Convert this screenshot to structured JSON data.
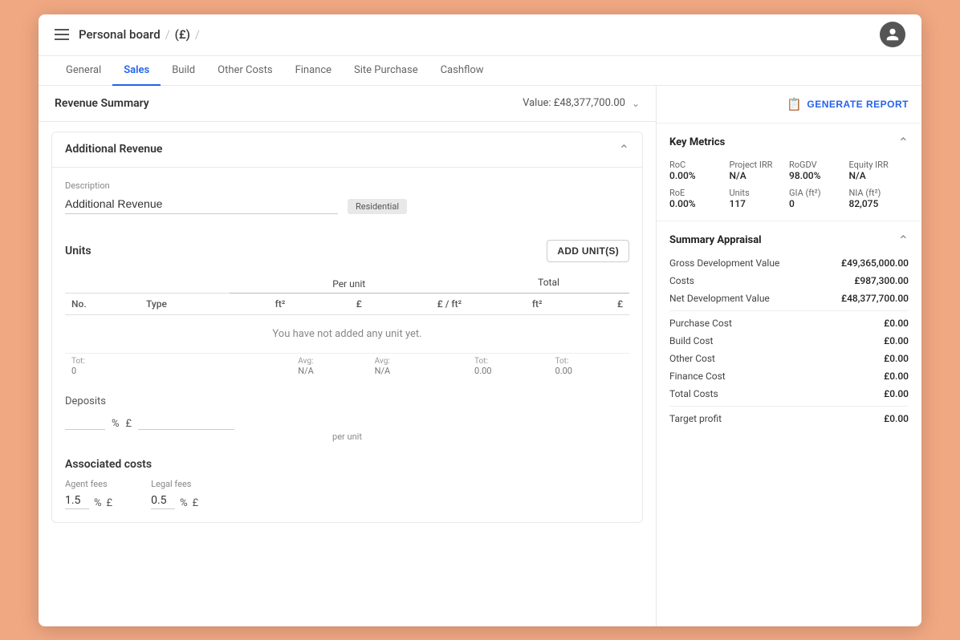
{
  "header": {
    "breadcrumb": {
      "title": "Personal board",
      "sep1": "/",
      "currency": "(£)",
      "sep2": "/"
    }
  },
  "tabs": [
    {
      "label": "General",
      "active": false
    },
    {
      "label": "Sales",
      "active": true
    },
    {
      "label": "Build",
      "active": false
    },
    {
      "label": "Other Costs",
      "active": false
    },
    {
      "label": "Finance",
      "active": false
    },
    {
      "label": "Site Purchase",
      "active": false
    },
    {
      "label": "Cashflow",
      "active": false
    }
  ],
  "revenue_summary": {
    "title": "Revenue Summary",
    "value_label": "Value: £48,377,700.00"
  },
  "additional_revenue": {
    "title": "Additional Revenue",
    "description_label": "Description",
    "description_value": "Additional Revenue",
    "badge": "Residential"
  },
  "units": {
    "title": "Units",
    "add_btn": "ADD UNIT(S)",
    "columns": {
      "no": "No.",
      "type": "Type",
      "per_unit": "Per unit",
      "ft2_per": "ft²",
      "gbp_per": "£",
      "gbp_per_ft2": "£ / ft²",
      "total": "Total",
      "ft2_tot": "ft²",
      "gbp_tot": "£"
    },
    "empty_message": "You have not added any unit yet.",
    "totals": {
      "no_label": "Tot:",
      "no_val": "0",
      "avg_label1": "Avg:",
      "avg_val1": "N/A",
      "avg_label2": "Avg:",
      "avg_val2": "N/A",
      "tot_label1": "Tot:",
      "tot_val1": "0.00",
      "tot_label2": "Tot:",
      "tot_val2": "0.00"
    }
  },
  "deposits": {
    "title": "Deposits",
    "percent_val": "",
    "pound_val": "",
    "per_unit_label": "per unit"
  },
  "associated_costs": {
    "title": "Associated costs",
    "agent_fees_label": "Agent fees",
    "agent_val": "1.5",
    "legal_fees_label": "Legal fees",
    "legal_val": "0.5"
  },
  "right_panel": {
    "generate_report_btn": "GENERATE REPORT",
    "key_metrics": {
      "title": "Key Metrics",
      "items": [
        {
          "label": "RoC",
          "value": "0.00%"
        },
        {
          "label": "Project IRR",
          "value": "N/A"
        },
        {
          "label": "RoGDV",
          "value": "98.00%"
        },
        {
          "label": "Equity IRR",
          "value": "N/A"
        },
        {
          "label": "RoE",
          "value": "0.00%"
        },
        {
          "label": "Units",
          "value": "117"
        },
        {
          "label": "GIA (ft²)",
          "value": "0"
        },
        {
          "label": "NIA (ft²)",
          "value": "82,075"
        }
      ]
    },
    "summary_appraisal": {
      "title": "Summary Appraisal",
      "rows": [
        {
          "label": "Gross Development Value",
          "value": "£49,365,000.00"
        },
        {
          "label": "Costs",
          "value": "£987,300.00"
        },
        {
          "label": "Net Development Value",
          "value": "£48,377,700.00"
        },
        {
          "label": "Purchase Cost",
          "value": "£0.00"
        },
        {
          "label": "Build Cost",
          "value": "£0.00"
        },
        {
          "label": "Other Cost",
          "value": "£0.00"
        },
        {
          "label": "Finance Cost",
          "value": "£0.00"
        },
        {
          "label": "Total Costs",
          "value": "£0.00"
        },
        {
          "label": "Target profit",
          "value": "£0.00"
        }
      ]
    }
  }
}
